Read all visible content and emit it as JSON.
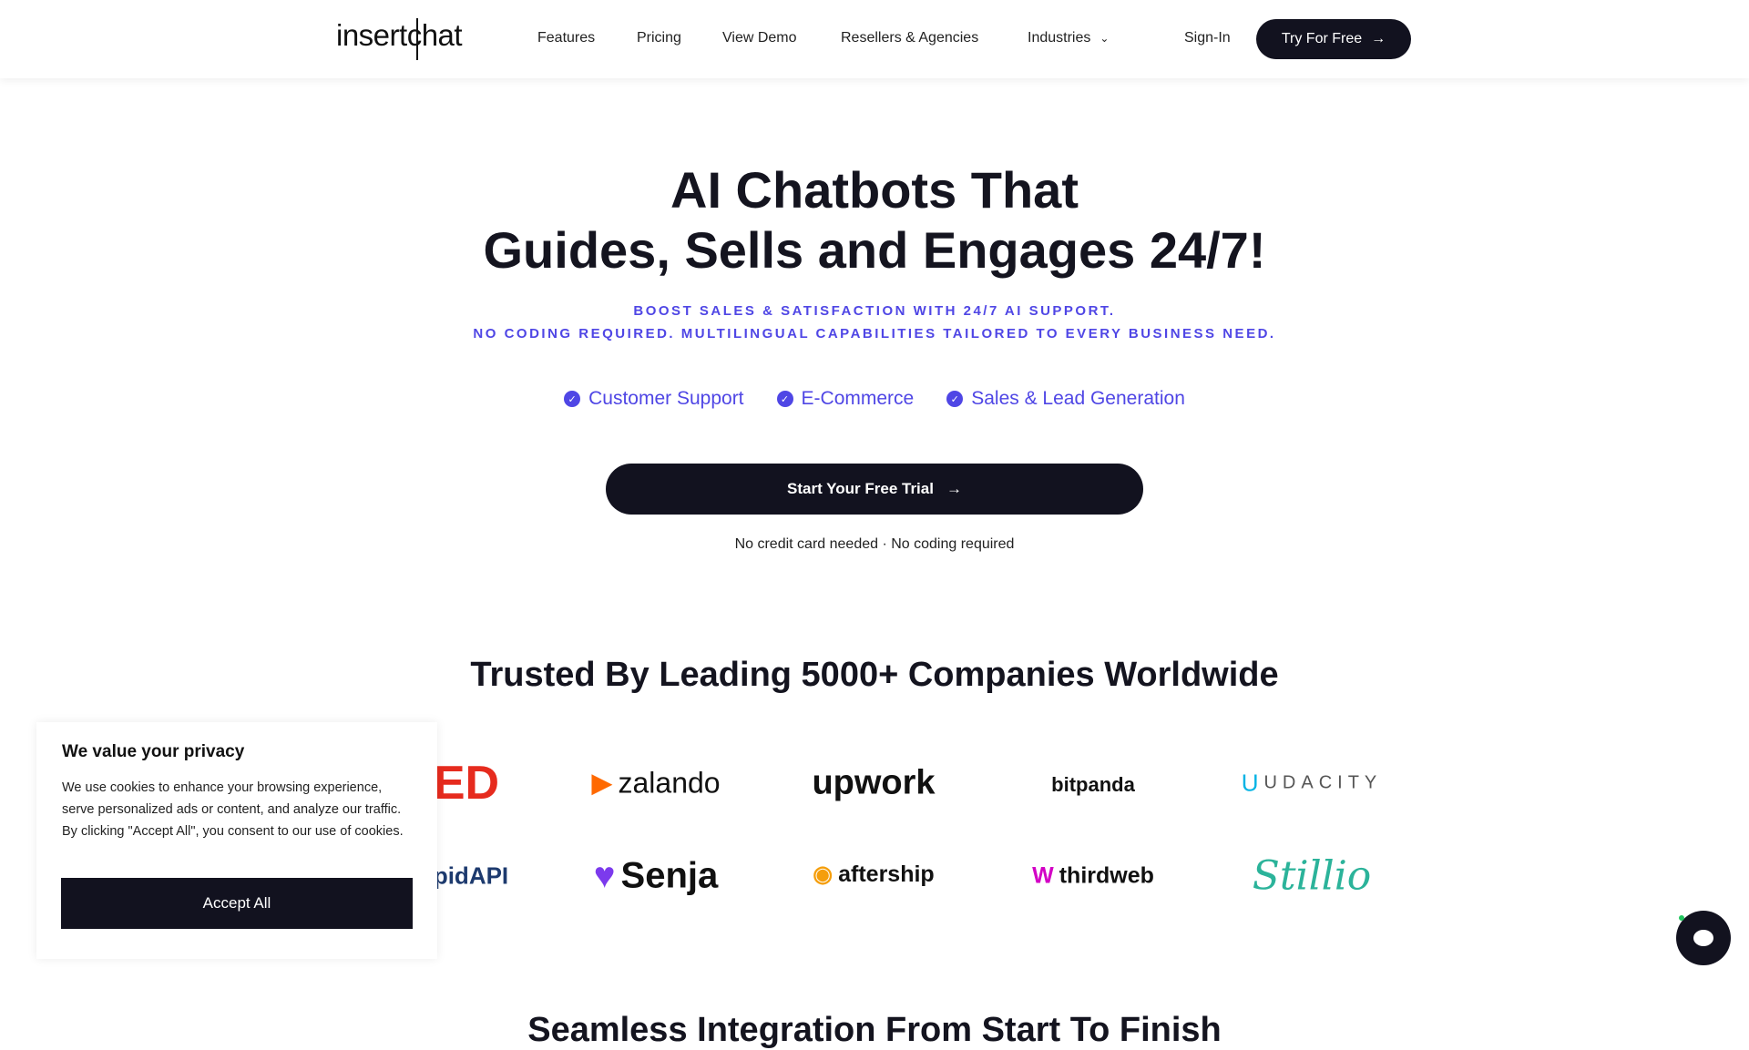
{
  "nav": {
    "logo": "insertchat",
    "links": [
      "Features",
      "Pricing",
      "View Demo",
      "Resellers & Agencies",
      "Industries"
    ],
    "sign_in": "Sign-In",
    "try_label": "Try For Free"
  },
  "hero": {
    "title_line1": "AI Chatbots That",
    "title_line2": "Guides, Sells and Engages 24/7!",
    "sub_line1": "BOOST SALES & SATISFACTION WITH 24/7 AI SUPPORT.",
    "sub_line2": "NO CODING REQUIRED. MULTILINGUAL CAPABILITIES TAILORED TO EVERY BUSINESS NEED.",
    "features": [
      "Customer Support",
      "E-Commerce",
      "Sales & Lead Generation"
    ],
    "cta": "Start Your Free Trial",
    "note": "No credit card needed · No coding required",
    "accent": "#4f46e5"
  },
  "trusted": {
    "title": "Trusted By Leading 5000+ Companies Worldwide",
    "logos_row1": [
      "ED",
      "zalando",
      "upwork",
      "bitpanda",
      "UDACITY"
    ],
    "logos_row2": [
      "pidAPI",
      "Senja",
      "aftership",
      "thirdweb",
      "Stillio"
    ]
  },
  "integration": {
    "title": "Seamless Integration From Start To Finish"
  },
  "cookie": {
    "title": "We value your privacy",
    "body": "We use cookies to enhance your browsing experience, serve personalized ads or content, and analyze our traffic. By clicking \"Accept All\", you consent to our use of cookies.",
    "accept": "Accept All"
  }
}
